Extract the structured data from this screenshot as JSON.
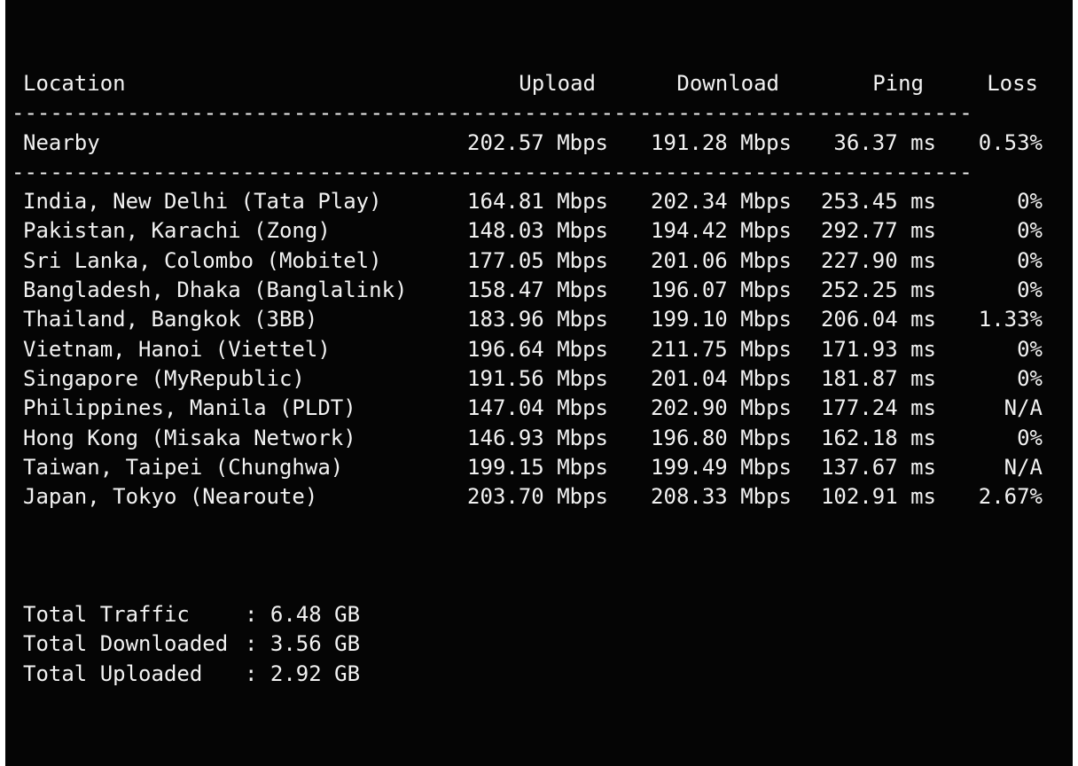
{
  "header": {
    "location": "Location",
    "upload": "Upload",
    "download": "Download",
    "ping": "Ping",
    "loss": "Loss"
  },
  "separator": "---------------------------------------------------------------------------",
  "nearby": {
    "location": "Nearby",
    "upload": "202.57 Mbps",
    "download": "191.28 Mbps",
    "ping": "36.37 ms",
    "loss": "0.53%"
  },
  "rows": [
    {
      "location": "India, New Delhi (Tata Play)",
      "upload": "164.81 Mbps",
      "download": "202.34 Mbps",
      "ping": "253.45 ms",
      "loss": "0%"
    },
    {
      "location": "Pakistan, Karachi (Zong)",
      "upload": "148.03 Mbps",
      "download": "194.42 Mbps",
      "ping": "292.77 ms",
      "loss": "0%"
    },
    {
      "location": "Sri Lanka, Colombo (Mobitel)",
      "upload": "177.05 Mbps",
      "download": "201.06 Mbps",
      "ping": "227.90 ms",
      "loss": "0%"
    },
    {
      "location": "Bangladesh, Dhaka (Banglalink)",
      "upload": "158.47 Mbps",
      "download": "196.07 Mbps",
      "ping": "252.25 ms",
      "loss": "0%"
    },
    {
      "location": "Thailand, Bangkok (3BB)",
      "upload": "183.96 Mbps",
      "download": "199.10 Mbps",
      "ping": "206.04 ms",
      "loss": "1.33%"
    },
    {
      "location": "Vietnam, Hanoi (Viettel)",
      "upload": "196.64 Mbps",
      "download": "211.75 Mbps",
      "ping": "171.93 ms",
      "loss": "0%"
    },
    {
      "location": "Singapore (MyRepublic)",
      "upload": "191.56 Mbps",
      "download": "201.04 Mbps",
      "ping": "181.87 ms",
      "loss": "0%"
    },
    {
      "location": "Philippines, Manila (PLDT)",
      "upload": "147.04 Mbps",
      "download": "202.90 Mbps",
      "ping": "177.24 ms",
      "loss": "N/A"
    },
    {
      "location": "Hong Kong (Misaka Network)",
      "upload": "146.93 Mbps",
      "download": "196.80 Mbps",
      "ping": "162.18 ms",
      "loss": "0%"
    },
    {
      "location": "Taiwan, Taipei (Chunghwa)",
      "upload": "199.15 Mbps",
      "download": "199.49 Mbps",
      "ping": "137.67 ms",
      "loss": "N/A"
    },
    {
      "location": "Japan, Tokyo (Nearoute)",
      "upload": "203.70 Mbps",
      "download": "208.33 Mbps",
      "ping": "102.91 ms",
      "loss": "2.67%"
    }
  ],
  "totals": [
    {
      "label": "Total Traffic",
      "colon": ":",
      "value": "6.48 GB"
    },
    {
      "label": "Total Downloaded",
      "colon": ":",
      "value": "3.56 GB"
    },
    {
      "label": "Total Uploaded",
      "colon": ":",
      "value": "2.92 GB"
    }
  ],
  "colors": {
    "background": "#050505",
    "text": "#f2f2f2"
  }
}
